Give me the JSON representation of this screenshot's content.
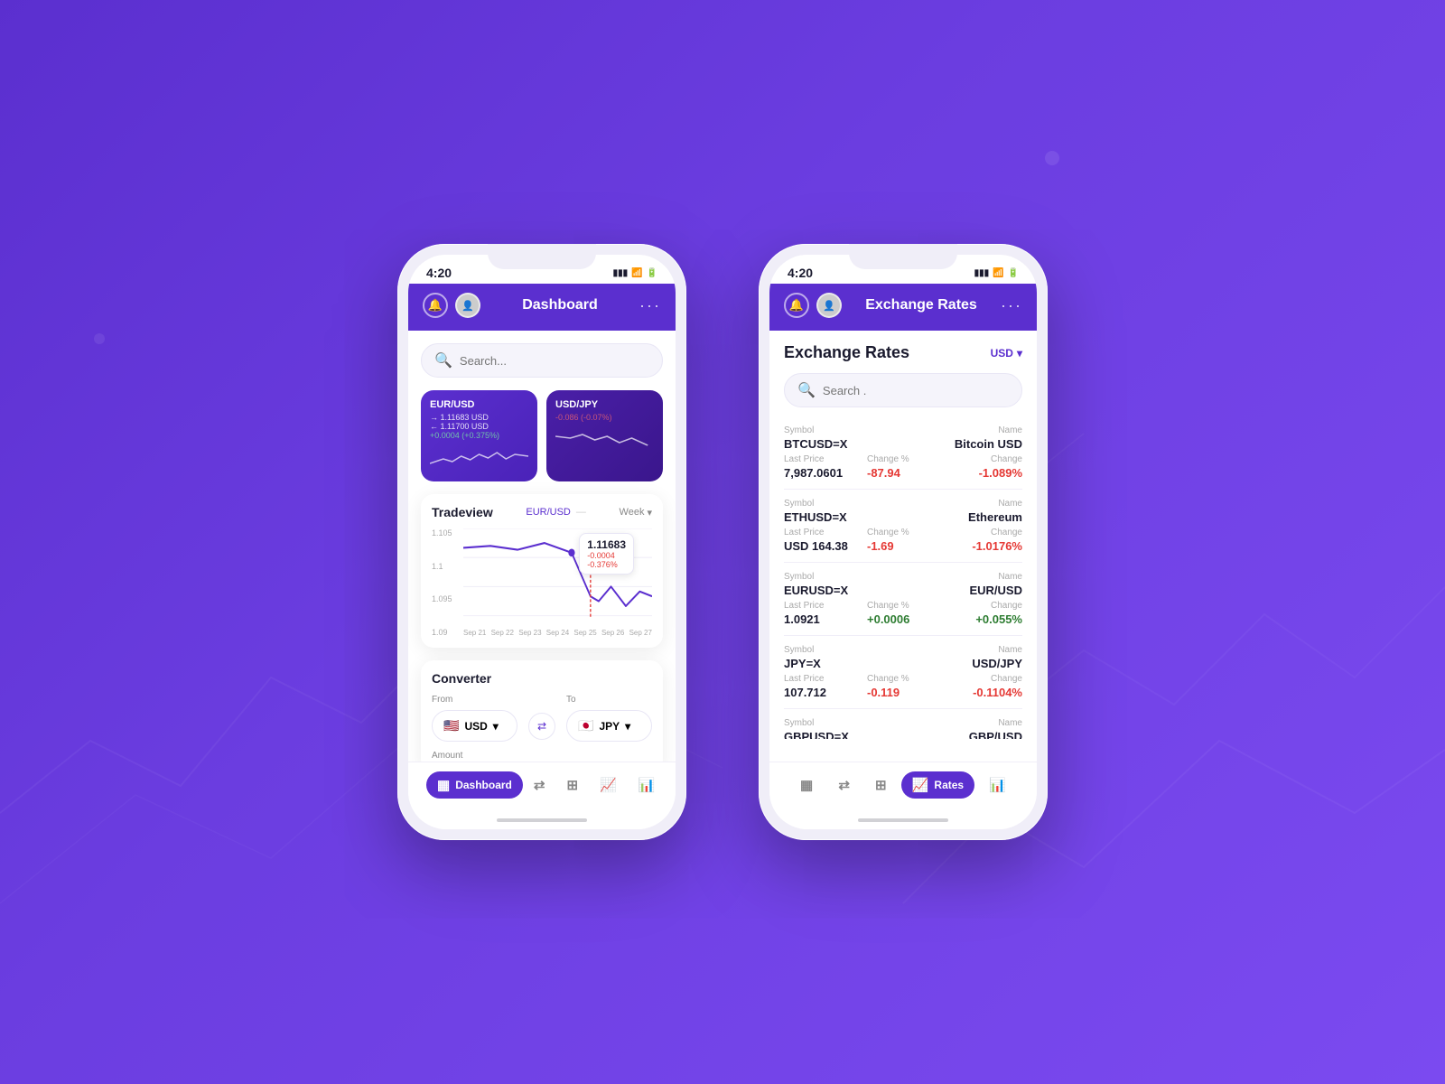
{
  "background": {
    "gradient_start": "#5b2fcf",
    "gradient_end": "#7b4af0"
  },
  "left_phone": {
    "status_time": "4:20",
    "title": "Dashboard",
    "search_placeholder": "Search...",
    "eur_usd_card": {
      "pair": "EUR/USD",
      "rate1": "→ 1.11683 USD",
      "rate2": "← 1.11700 USD",
      "change": "+0.0004 (+0.375%)"
    },
    "usd_jpy_card": {
      "pair": "USD/JPY",
      "change": "-0.086 (-0.07%)"
    },
    "tradeview": {
      "title": "Tradeview",
      "pair": "EUR/USD",
      "period": "Week",
      "tooltip_price": "1.11683",
      "tooltip_change1": "-0.0004",
      "tooltip_change2": "-0.376%",
      "y_labels": [
        "1.105",
        "1.1",
        "1.095",
        "1.09"
      ],
      "x_labels": [
        "Sep 21",
        "Sep 22",
        "Sep 23",
        "Sep 24",
        "Sep 25",
        "Sep 26",
        "Sep 27"
      ]
    },
    "converter": {
      "title": "Converter",
      "from_label": "From",
      "to_label": "To",
      "from_currency": "USD",
      "to_currency": "JPY",
      "amount_label": "Amount"
    },
    "nav": {
      "items": [
        {
          "label": "Dashboard",
          "icon": "▦",
          "active": true
        },
        {
          "label": "",
          "icon": "⇄",
          "active": false
        },
        {
          "label": "",
          "icon": "⊞",
          "active": false
        },
        {
          "label": "",
          "icon": "📈",
          "active": false
        },
        {
          "label": "",
          "icon": "📊",
          "active": false
        }
      ]
    }
  },
  "right_phone": {
    "status_time": "4:20",
    "title": "Exchange Rates",
    "currency_selector": "USD",
    "search_placeholder": "Search .",
    "rates_title": "Exchange Rates",
    "rates": [
      {
        "symbol": "BTCUSD=X",
        "name": "Bitcoin USD",
        "last_price": "7,987.0601",
        "change_pct": "-87.94",
        "change": "-1.089%",
        "positive": false
      },
      {
        "symbol": "ETHUSD=X",
        "name": "Ethereum",
        "last_price": "USD 164.38",
        "change_pct": "-1.69",
        "change": "-1.0176%",
        "positive": false
      },
      {
        "symbol": "EURUSD=X",
        "name": "EUR/USD",
        "last_price": "1.0921",
        "change_pct": "+0.0006",
        "change": "+0.055%",
        "positive": true
      },
      {
        "symbol": "JPY=X",
        "name": "USD/JPY",
        "last_price": "107.712",
        "change_pct": "-0.119",
        "change": "-0.1104%",
        "positive": false
      },
      {
        "symbol": "GBPUSD=X",
        "name": "GBP/USD",
        "last_price": "",
        "change_pct": "",
        "change": "",
        "positive": false
      }
    ],
    "nav": {
      "items": [
        {
          "label": "",
          "icon": "▦",
          "active": false
        },
        {
          "label": "",
          "icon": "⇄",
          "active": false
        },
        {
          "label": "",
          "icon": "⊞",
          "active": false
        },
        {
          "label": "Rates",
          "icon": "📈",
          "active": true
        },
        {
          "label": "",
          "icon": "📊",
          "active": false
        }
      ]
    }
  },
  "labels": {
    "symbol": "Symbol",
    "name": "Name",
    "last_price": "Last Price",
    "change_pct": "Change %",
    "change": "Change"
  }
}
